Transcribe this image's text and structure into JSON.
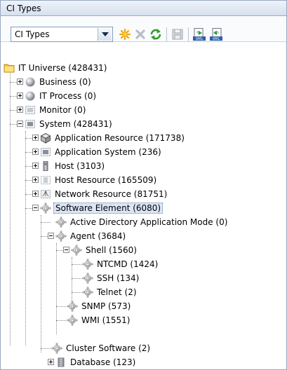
{
  "panel": {
    "title": "CI Types"
  },
  "toolbar": {
    "selector_value": "CI Types",
    "buttons": [
      {
        "name": "new",
        "icon": "star-icon"
      },
      {
        "name": "delete",
        "icon": "delete-x-icon"
      },
      {
        "name": "refresh",
        "icon": "refresh-icon"
      },
      {
        "name": "save",
        "icon": "save-icon"
      },
      {
        "name": "export-xml",
        "icon": "export-xml-icon",
        "badge": "XML"
      },
      {
        "name": "import-xml",
        "icon": "import-xml-icon",
        "badge": "XML"
      }
    ]
  },
  "tree": {
    "root": {
      "label": "IT Universe (428431)",
      "icon": "folder-icon"
    },
    "items": [
      {
        "label": "Business (0)",
        "icon": "sphere-icon"
      },
      {
        "label": "IT Process (0)",
        "icon": "sphere-icon"
      },
      {
        "label": "Monitor (0)",
        "icon": "monitor-icon"
      },
      {
        "label": "System (428431)",
        "icon": "system-icon"
      },
      {
        "label": "Application Resource (171738)",
        "icon": "cube-icon"
      },
      {
        "label": "Application System (236)",
        "icon": "system-icon"
      },
      {
        "label": "Host (3103)",
        "icon": "host-icon"
      },
      {
        "label": "Host Resource (165509)",
        "icon": "host-resource-icon"
      },
      {
        "label": "Network Resource (81751)",
        "icon": "network-icon"
      },
      {
        "label": "Software Element (6080)",
        "icon": "gear-icon",
        "selected": true
      },
      {
        "label": "Active Directory Application Mode (0)",
        "icon": "gear-icon"
      },
      {
        "label": "Agent (3684)",
        "icon": "gear-icon"
      },
      {
        "label": "Shell (1560)",
        "icon": "gear-icon"
      },
      {
        "label": "NTCMD (1424)",
        "icon": "gear-icon"
      },
      {
        "label": "SSH (134)",
        "icon": "gear-icon"
      },
      {
        "label": "Telnet (2)",
        "icon": "gear-icon"
      },
      {
        "label": "SNMP (573)",
        "icon": "gear-icon"
      },
      {
        "label": "WMI (1551)",
        "icon": "gear-icon"
      },
      {
        "label": "Cluster Software (2)",
        "icon": "gear-icon"
      },
      {
        "label": "Database (123)",
        "icon": "database-icon"
      }
    ]
  }
}
